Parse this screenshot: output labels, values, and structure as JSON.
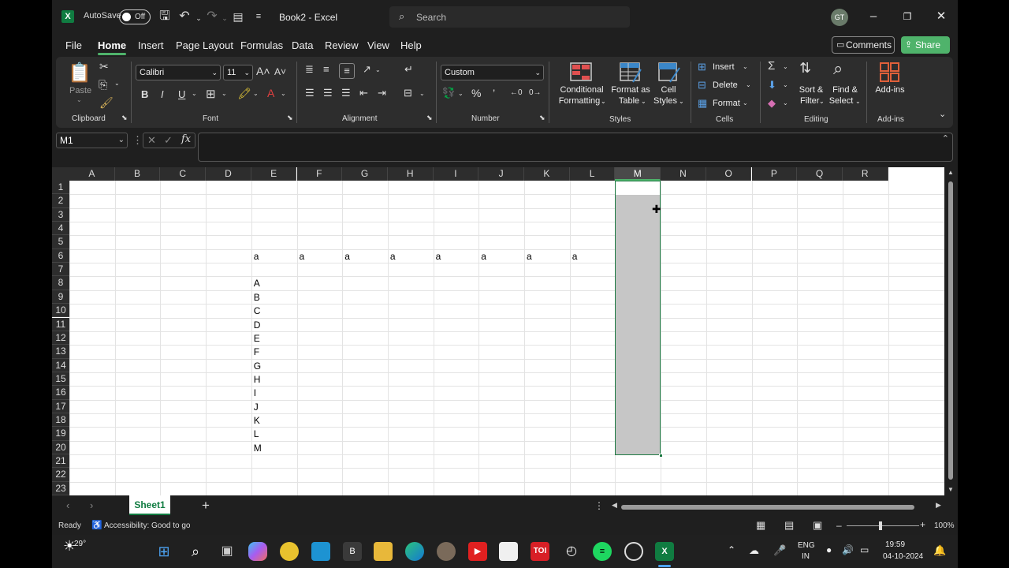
{
  "titlebar": {
    "autosave_label": "AutoSave",
    "autosave_state": "Off",
    "title": "Book2  -  Excel",
    "search_placeholder": "Search",
    "avatar_initials": "GT"
  },
  "menu": {
    "tabs": [
      "File",
      "Home",
      "Insert",
      "Page Layout",
      "Formulas",
      "Data",
      "Review",
      "View",
      "Help"
    ],
    "active_tab": "Home",
    "comments_label": "Comments",
    "share_label": "Share"
  },
  "ribbon": {
    "clipboard": {
      "paste_label": "Paste",
      "group_label": "Clipboard"
    },
    "font": {
      "family": "Calibri",
      "size": "11",
      "group_label": "Font"
    },
    "alignment": {
      "group_label": "Alignment"
    },
    "number": {
      "format": "Custom",
      "group_label": "Number"
    },
    "styles": {
      "conditional_label": "Conditional",
      "conditional_label2": "Formatting",
      "format_table_label": "Format as",
      "format_table_label2": "Table",
      "cell_styles_label": "Cell",
      "cell_styles_label2": "Styles",
      "group_label": "Styles"
    },
    "cells": {
      "insert_label": "Insert",
      "delete_label": "Delete",
      "format_label": "Format",
      "group_label": "Cells"
    },
    "editing": {
      "sort_label": "Sort &",
      "sort_label2": "Filter",
      "find_label": "Find &",
      "find_label2": "Select",
      "group_label": "Editing"
    },
    "addins": {
      "label": "Add-ins",
      "group_label": "Add-ins"
    }
  },
  "formula_bar": {
    "name_box": "M1",
    "formula": ""
  },
  "grid": {
    "columns": [
      "A",
      "B",
      "C",
      "D",
      "E",
      "F",
      "G",
      "H",
      "I",
      "J",
      "K",
      "L",
      "M",
      "N",
      "O",
      "P",
      "Q",
      "R"
    ],
    "rows": [
      "1",
      "2",
      "3",
      "4",
      "5",
      "6",
      "7",
      "8",
      "9",
      "10",
      "11",
      "12",
      "13",
      "14",
      "15",
      "16",
      "17",
      "18",
      "19",
      "20",
      "21",
      "22",
      "23"
    ],
    "selected_column": "M",
    "row6_values": [
      "a",
      "a",
      "a",
      "a",
      "a",
      "a",
      "a",
      "a"
    ],
    "columnE_values": [
      "A",
      "B",
      "C",
      "D",
      "E",
      "F",
      "G",
      "H",
      "I",
      "J",
      "K",
      "L",
      "M"
    ]
  },
  "sheets": {
    "tabs": [
      "Sheet1"
    ],
    "active": "Sheet1"
  },
  "status": {
    "mode": "Ready",
    "accessibility": "Accessibility: Good to go",
    "zoom": "100%"
  },
  "taskbar": {
    "weather_temp": "29°",
    "toi_label": "TOI",
    "b_label": "B",
    "lang_line1": "ENG",
    "lang_line2": "IN",
    "time": "19:59",
    "date": "04-10-2024"
  },
  "colors": {
    "accent_green": "#4fb36b",
    "excel_green": "#107c41",
    "selection_fill": "#c6c6c6"
  }
}
